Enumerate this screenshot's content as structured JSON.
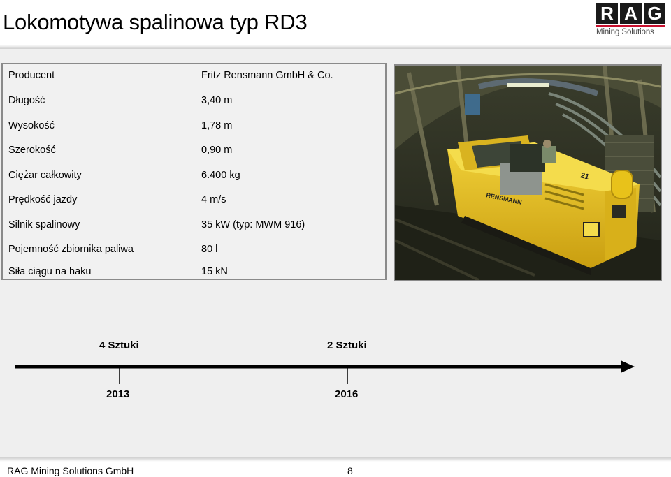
{
  "title": "Lokomotywa spalinowa typ RD3",
  "logo": {
    "letters": [
      "R",
      "A",
      "G"
    ],
    "subtitle": "Mining Solutions"
  },
  "specs": [
    {
      "label": "Producent",
      "value": "Fritz Rensmann GmbH & Co."
    },
    {
      "label": "Długość",
      "value": "3,40 m"
    },
    {
      "label": "Wysokość",
      "value": "1,78 m"
    },
    {
      "label": "Szerokość",
      "value": "0,90 m"
    },
    {
      "label": "Ciężar całkowity",
      "value": "6.400 kg"
    },
    {
      "label": "Prędkość jazdy",
      "value": "4 m/s"
    },
    {
      "label": "Silnik spalinowy",
      "value": "35 kW (typ: MWM 916)"
    },
    {
      "label": "Pojemność zbiornika paliwa",
      "value": "80 l"
    },
    {
      "label": "Siła ciągu na haku",
      "value": "15 kN"
    }
  ],
  "photo": {
    "loco_text": "RENSMANN",
    "loco_number": "21"
  },
  "timeline": {
    "events": [
      {
        "quantity": "4 Sztuki",
        "year": "2013"
      },
      {
        "quantity": "2 Sztuki",
        "year": "2016"
      }
    ]
  },
  "footer": {
    "company": "RAG Mining Solutions GmbH",
    "page": "8"
  },
  "colors": {
    "logo_red": "#c8102e",
    "locomotive_yellow": "#e8c21a"
  }
}
